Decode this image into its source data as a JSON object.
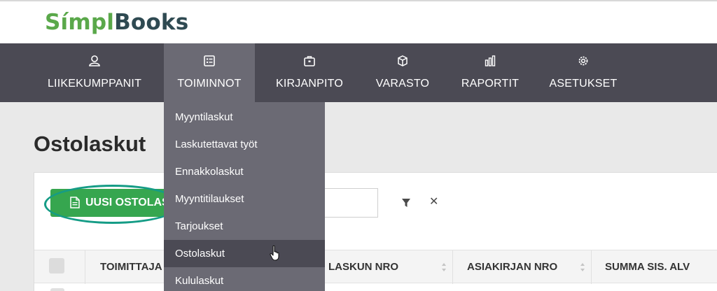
{
  "brand": {
    "part1": "Símpl",
    "part2": "Books"
  },
  "nav": {
    "items": [
      {
        "label": "LIIKEKUMPPANIT",
        "icon": "user-icon"
      },
      {
        "label": "TOIMINNOT",
        "icon": "list-icon"
      },
      {
        "label": "KIRJANPITO",
        "icon": "briefcase-icon"
      },
      {
        "label": "VARASTO",
        "icon": "boxes-icon"
      },
      {
        "label": "RAPORTIT",
        "icon": "bar-chart-icon"
      },
      {
        "label": "ASETUKSET",
        "icon": "gear-icon"
      }
    ],
    "active": "TOIMINNOT"
  },
  "dropdown": {
    "items": [
      {
        "label": "Myyntilaskut"
      },
      {
        "label": "Laskutettavat työt"
      },
      {
        "label": "Ennakkolaskut"
      },
      {
        "label": "Myyntitilaukset"
      },
      {
        "label": "Tarjoukset"
      },
      {
        "label": "Ostolaskut"
      },
      {
        "label": "Kululaskut"
      }
    ],
    "hovered": "Ostolaskut"
  },
  "page": {
    "title": "Ostolaskut"
  },
  "toolbar": {
    "new_button": "UUSI OSTOLAS"
  },
  "table": {
    "columns": [
      "TOIMITTAJA",
      "LASKUN NRO",
      "ASIAKIRJAN NRO",
      "SUMMA SIS. ALV"
    ]
  },
  "colors": {
    "brand_green": "#5aa84a",
    "brand_dark": "#2f4a52",
    "nav_bg": "#4b4a54",
    "nav_active": "#6b6a74",
    "button_green": "#36a64f",
    "highlight": "#159c86"
  }
}
